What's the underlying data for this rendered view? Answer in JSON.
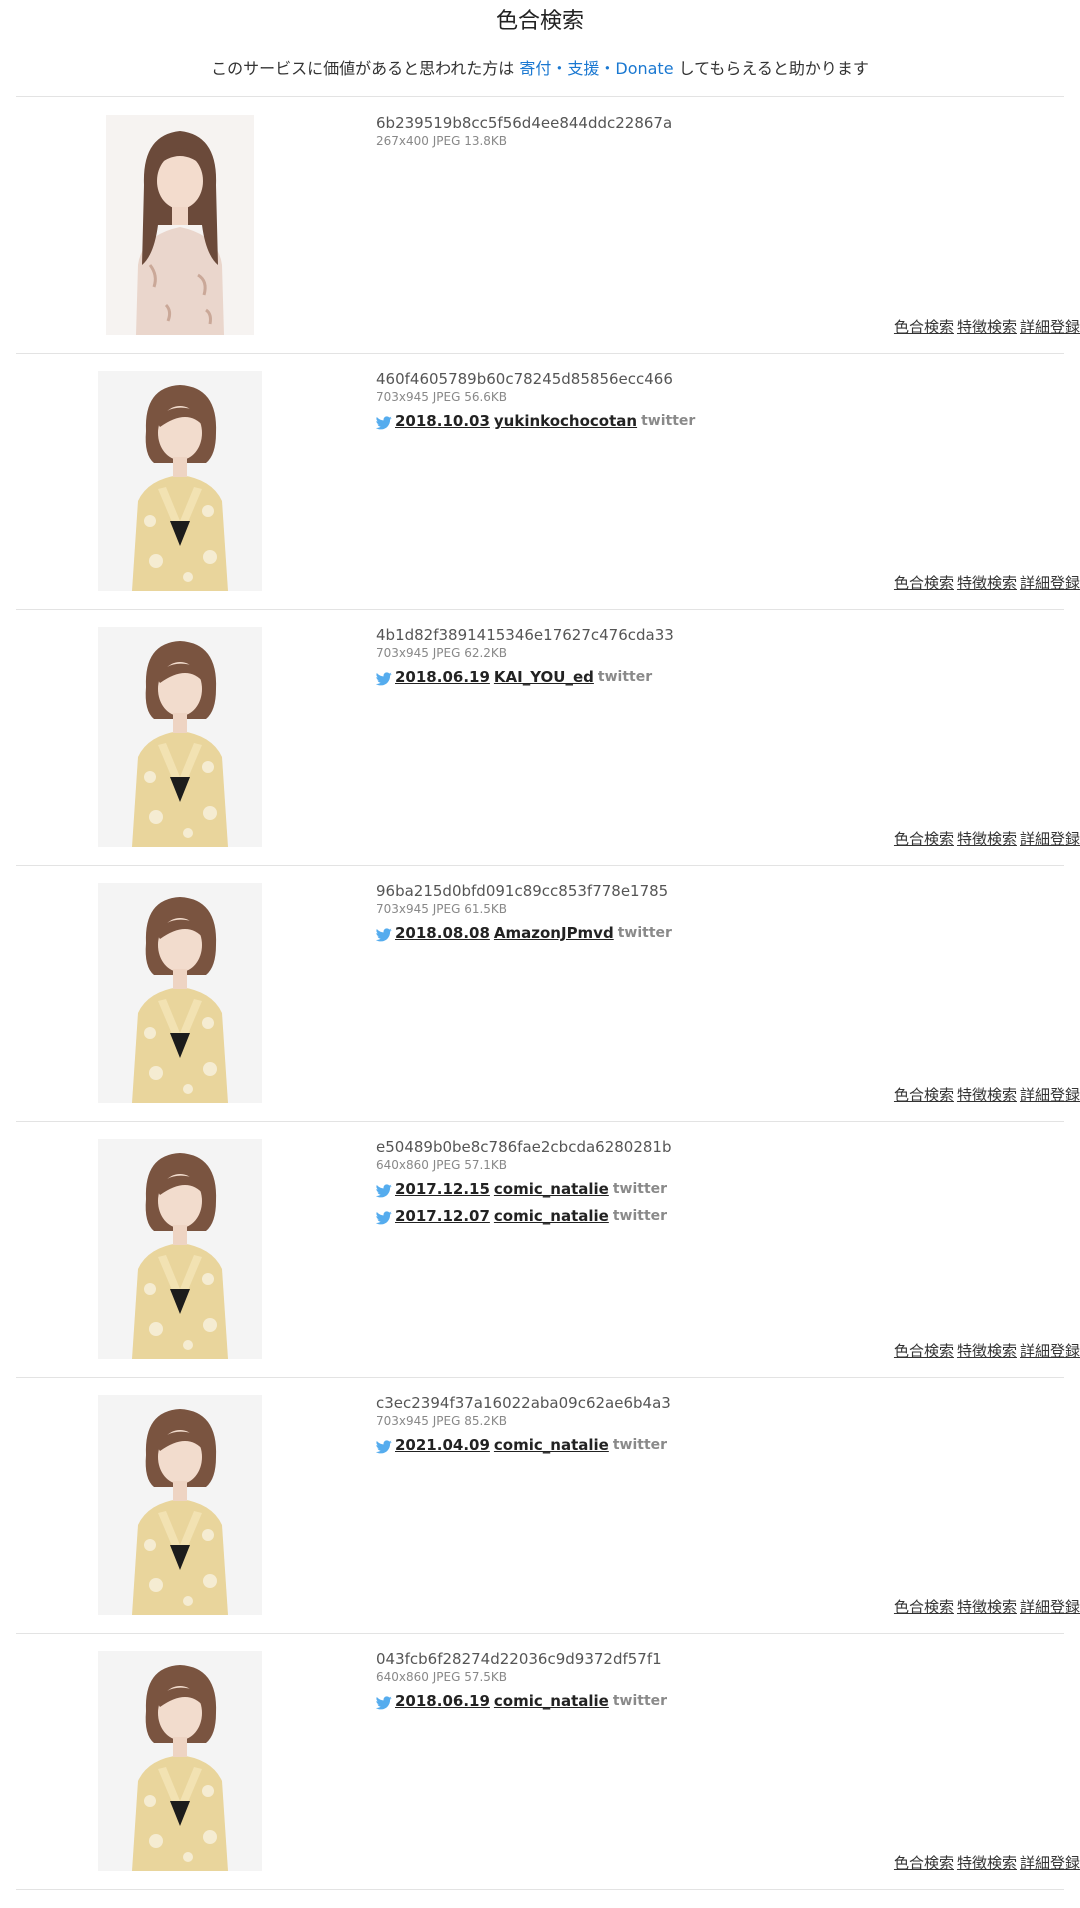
{
  "page": {
    "title": "色合検索",
    "notice_before": "このサービスに価値があると思われた方は",
    "notice_link": "寄付・支援・Donate",
    "notice_after": "してもらえると助かります"
  },
  "actions": {
    "color_search": "色合検索",
    "feature_search": "特徴検索",
    "detail_register": "詳細登録"
  },
  "results": [
    {
      "hash": "6b239519b8cc5f56d4ee844ddc22867a",
      "meta": "267x400 JPEG 13.8KB",
      "thumbnail": "portrait-woman-long-hair-floral-blouse",
      "sources": []
    },
    {
      "hash": "460f4605789b60c78245d85856ecc466",
      "meta": "703x945 JPEG 56.6KB",
      "thumbnail": "portrait-woman-short-hair-yellow-floral-dress",
      "sources": [
        {
          "icon": "twitter-bird-icon",
          "date": "2018.10.03",
          "account": "yukinkochocotan",
          "site": "twitter"
        }
      ]
    },
    {
      "hash": "4b1d82f3891415346e17627c476cda33",
      "meta": "703x945 JPEG 62.2KB",
      "thumbnail": "portrait-woman-short-hair-yellow-floral-dress",
      "sources": [
        {
          "icon": "twitter-bird-icon",
          "date": "2018.06.19",
          "account": "KAI_YOU_ed",
          "site": "twitter"
        }
      ]
    },
    {
      "hash": "96ba215d0bfd091c89cc853f778e1785",
      "meta": "703x945 JPEG 61.5KB",
      "thumbnail": "portrait-woman-short-hair-yellow-floral-dress",
      "sources": [
        {
          "icon": "twitter-bird-icon",
          "date": "2018.08.08",
          "account": "AmazonJPmvd",
          "site": "twitter"
        }
      ]
    },
    {
      "hash": "e50489b0be8c786fae2cbcda6280281b",
      "meta": "640x860 JPEG 57.1KB",
      "thumbnail": "portrait-woman-short-hair-yellow-floral-dress",
      "sources": [
        {
          "icon": "twitter-bird-icon",
          "date": "2017.12.15",
          "account": "comic_natalie",
          "site": "twitter"
        },
        {
          "icon": "twitter-bird-icon",
          "date": "2017.12.07",
          "account": "comic_natalie",
          "site": "twitter"
        }
      ]
    },
    {
      "hash": "c3ec2394f37a16022aba09c62ae6b4a3",
      "meta": "703x945 JPEG 85.2KB",
      "thumbnail": "portrait-woman-short-hair-yellow-floral-dress",
      "sources": [
        {
          "icon": "twitter-bird-icon",
          "date": "2021.04.09",
          "account": "comic_natalie",
          "site": "twitter"
        }
      ]
    },
    {
      "hash": "043fcb6f28274d22036c9d9372df57f1",
      "meta": "640x860 JPEG 57.5KB",
      "thumbnail": "portrait-woman-short-hair-yellow-floral-dress",
      "sources": [
        {
          "icon": "twitter-bird-icon",
          "date": "2018.06.19",
          "account": "comic_natalie",
          "site": "twitter"
        }
      ]
    }
  ],
  "colors": {
    "link": "#1a78d1",
    "twitter": "#55acee",
    "divider": "#e3e3e3"
  }
}
